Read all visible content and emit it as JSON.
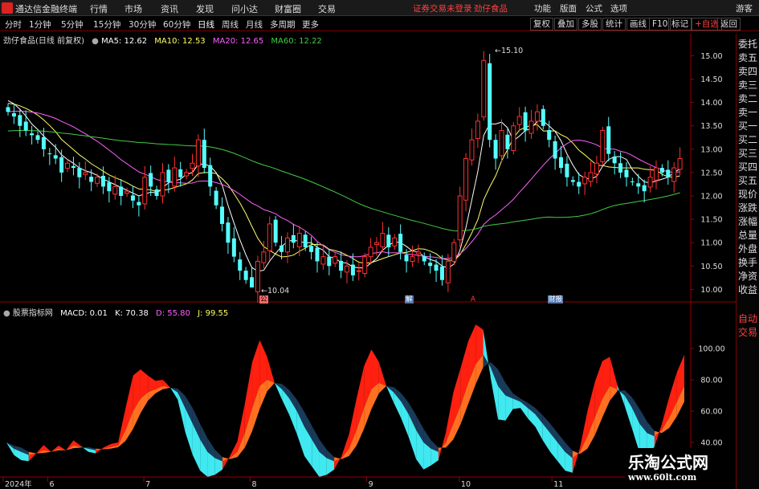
{
  "app": {
    "title": "通达信金融终端",
    "menu": [
      "行情",
      "市场",
      "资讯",
      "发现",
      "问小达",
      "财富圈",
      "交易"
    ],
    "notice": "证券交易未登录",
    "stock_tab": "劲仔食品",
    "tools": [
      "功能",
      "版面",
      "公式",
      "选项"
    ],
    "guest": "游客"
  },
  "periods": {
    "items": [
      "分时",
      "1分钟",
      "5分钟",
      "15分钟",
      "30分钟",
      "60分钟",
      "日线",
      "周线",
      "月线",
      "多周期",
      "更多"
    ],
    "active": "日线"
  },
  "toolbar": [
    "复权",
    "叠加",
    "多股",
    "统计",
    "画线",
    "F10",
    "标记",
    "+自选",
    "返回"
  ],
  "right_panel": {
    "labels": [
      "委托",
      "卖五",
      "卖四",
      "卖三",
      "卖二",
      "卖一",
      "买一",
      "买二",
      "买三",
      "买四",
      "买五",
      "现价",
      "涨跌",
      "涨幅",
      "总量",
      "外盘",
      "换手",
      "净资",
      "收益"
    ],
    "lower_labels": [
      "自动",
      "交易"
    ]
  },
  "colors": {
    "up": "#ff3030",
    "down": "#54ffff",
    "ma5": "#ffffff",
    "ma10": "#ffff66",
    "ma20": "#ff60ff",
    "ma60": "#44cc44",
    "axis": "#990000",
    "kdj_red": "#ff2010",
    "kdj_orange": "#ff7020",
    "kdj_cyan": "#40e8f0",
    "kdj_navy": "#1a3a5a"
  },
  "main_chart": {
    "title": "劲仔食品(日线 前复权)",
    "legend": [
      {
        "label": "MA5: 12.62",
        "color": "#ffffff"
      },
      {
        "label": "MA10: 12.53",
        "color": "#ffff66"
      },
      {
        "label": "MA20: 12.65",
        "color": "#ff60ff"
      },
      {
        "label": "MA60: 12.22",
        "color": "#44cc44"
      }
    ],
    "high_label": "15.10",
    "low_label": "10.04",
    "event_tags": [
      "公",
      "解",
      "A",
      "财报"
    ]
  },
  "sub_chart": {
    "title": "股票指标网",
    "legend": [
      {
        "label": "MACD: 0.01",
        "color": "#ffffff"
      },
      {
        "label": "K: 70.38",
        "color": "#ffffff"
      },
      {
        "label": "D: 55.80",
        "color": "#ff60ff"
      },
      {
        "label": "J: 99.55",
        "color": "#ffff66"
      }
    ]
  },
  "x_axis": {
    "labels": [
      "2024年",
      "6",
      "7",
      "8",
      "9",
      "10",
      "11"
    ],
    "positions": [
      0.0,
      0.065,
      0.205,
      0.36,
      0.53,
      0.665,
      0.8
    ]
  },
  "watermark": {
    "title": "乐淘公式网",
    "url": "www.60lt.com"
  },
  "chart_data": [
    {
      "type": "candlestick",
      "title": "劲仔食品(日线 前复权)",
      "ylim": [
        9.8,
        15.3
      ],
      "y_ticks": [
        10.0,
        10.5,
        11.0,
        11.5,
        12.0,
        12.5,
        13.0,
        13.5,
        14.0,
        14.5,
        15.0
      ],
      "closes": [
        13.8,
        13.7,
        13.5,
        13.4,
        13.3,
        13.2,
        13.0,
        12.9,
        12.8,
        12.5,
        12.7,
        12.6,
        12.4,
        12.5,
        12.3,
        12.4,
        12.2,
        12.1,
        12.2,
        12.0,
        12.1,
        11.9,
        11.8,
        12.4,
        12.2,
        12.0,
        12.5,
        12.3,
        12.6,
        12.4,
        12.5,
        12.7,
        13.2,
        12.6,
        12.2,
        11.8,
        11.4,
        11.0,
        10.7,
        10.4,
        10.2,
        10.04,
        10.6,
        10.8,
        11.4,
        11.0,
        10.8,
        11.1,
        11.0,
        11.2,
        10.9,
        10.8,
        10.6,
        10.7,
        10.5,
        10.7,
        10.4,
        10.5,
        10.3,
        10.4,
        10.7,
        10.9,
        11.0,
        11.2,
        10.9,
        11.1,
        10.8,
        10.6,
        10.7,
        10.8,
        10.6,
        10.5,
        10.4,
        10.2,
        10.6,
        11.0,
        12.0,
        12.8,
        13.2,
        13.6,
        14.9,
        13.2,
        12.8,
        13.4,
        13.0,
        13.5,
        13.7,
        13.4,
        13.6,
        13.8,
        13.5,
        13.2,
        12.8,
        12.6,
        12.4,
        12.3,
        12.2,
        12.4,
        12.5,
        12.7,
        13.4,
        12.9,
        12.7,
        12.5,
        12.4,
        12.3,
        12.2,
        12.1,
        12.4,
        12.6,
        12.5,
        12.4,
        12.6,
        12.8
      ],
      "high": 15.1,
      "low": 10.04,
      "series": [
        {
          "name": "MA5",
          "last": 12.62
        },
        {
          "name": "MA10",
          "last": 12.53
        },
        {
          "name": "MA20",
          "last": 12.65
        },
        {
          "name": "MA60",
          "last": 12.22
        }
      ]
    },
    {
      "type": "area",
      "title": "股票指标网",
      "ylim": [
        20,
        120
      ],
      "y_ticks": [
        20.0,
        40.0,
        60.0,
        80.0,
        100.0
      ],
      "series": [
        {
          "name": "K",
          "last": 70.38
        },
        {
          "name": "D",
          "last": 55.8
        },
        {
          "name": "J",
          "last": 99.55
        }
      ],
      "k_values": [
        40,
        36,
        34,
        32,
        33,
        35,
        34,
        36,
        35,
        38,
        37,
        36,
        35,
        36,
        37,
        38,
        48,
        60,
        68,
        72,
        74,
        76,
        75,
        72,
        62,
        52,
        42,
        34,
        30,
        28,
        30,
        34,
        46,
        62,
        76,
        80,
        78,
        74,
        68,
        60,
        50,
        42,
        34,
        30,
        28,
        30,
        36,
        48,
        62,
        74,
        78,
        76,
        72,
        66,
        58,
        48,
        40,
        36,
        34,
        40,
        52,
        64,
        78,
        90,
        96,
        88,
        76,
        70,
        68,
        66,
        62,
        58,
        52,
        46,
        40,
        34,
        30,
        34,
        44,
        56,
        68,
        76,
        74,
        70,
        62,
        52,
        46,
        44,
        48,
        56,
        66,
        76
      ]
    }
  ]
}
